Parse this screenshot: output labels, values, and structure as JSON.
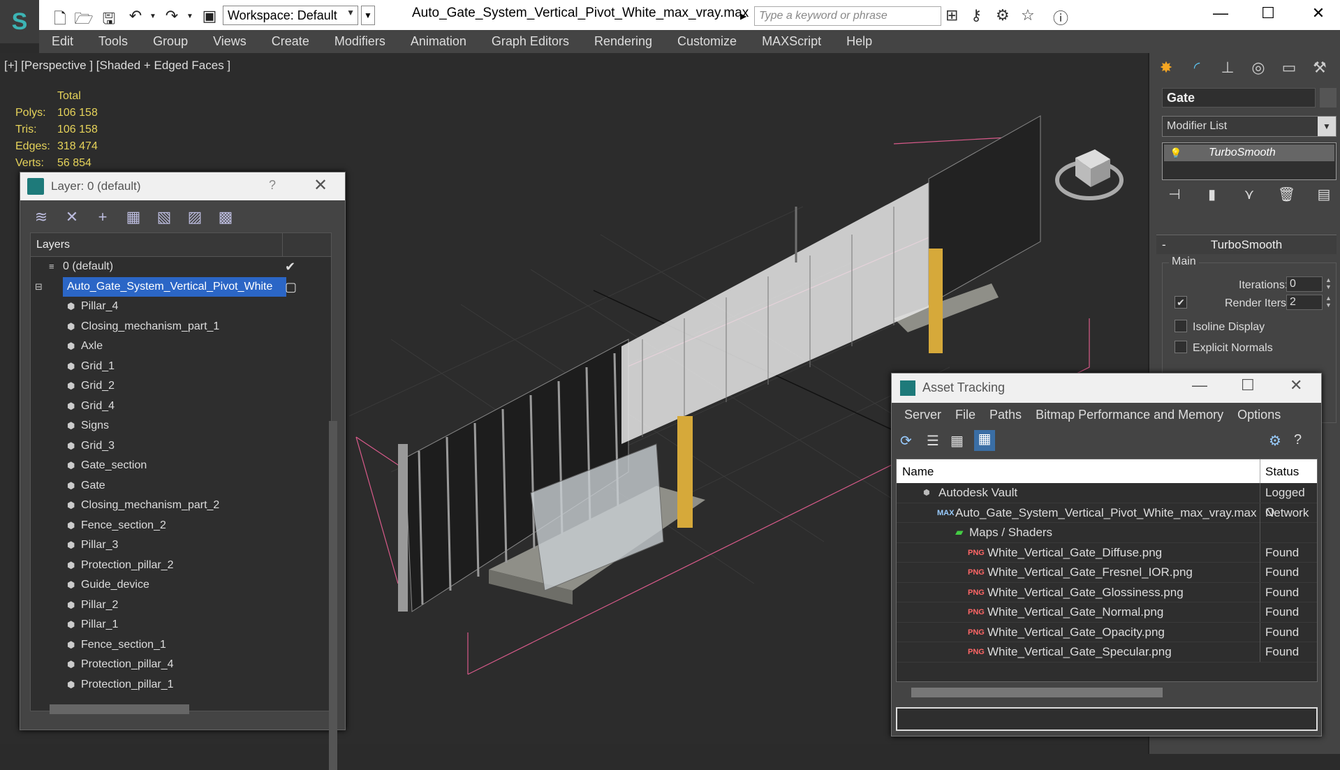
{
  "app": {
    "file_title": "Auto_Gate_System_Vertical_Pivot_White_max_vray.max",
    "workspace": "Workspace: Default",
    "search_placeholder": "Type a keyword or phrase"
  },
  "menu": [
    "Edit",
    "Tools",
    "Group",
    "Views",
    "Create",
    "Modifiers",
    "Animation",
    "Graph Editors",
    "Rendering",
    "Customize",
    "MAXScript",
    "Help"
  ],
  "viewport": {
    "label": "[+] [Perspective ] [Shaded + Edged Faces ]",
    "stats_header": "Total",
    "stats": [
      {
        "k": "Polys:",
        "v": "106 158"
      },
      {
        "k": "Tris:",
        "v": "106 158"
      },
      {
        "k": "Edges:",
        "v": "318 474"
      },
      {
        "k": "Verts:",
        "v": "56 854"
      }
    ]
  },
  "command_panel": {
    "object_name": "Gate",
    "modifier_list": "Modifier List",
    "stack_item": "TurboSmooth",
    "rollout_title": "TurboSmooth",
    "group_main": "Main",
    "iterations_label": "Iterations:",
    "iterations_value": "0",
    "render_iters_label": "Render Iters:",
    "render_iters_value": "2",
    "render_iters_checked": "✔",
    "isoline_label": "Isoline Display",
    "explicit_normals_label": "Explicit Normals"
  },
  "layer_window": {
    "title": "Layer: 0 (default)",
    "help": "?",
    "header": "Layers",
    "default_layer": "0 (default)",
    "selected_layer": "Auto_Gate_System_Vertical_Pivot_White",
    "objects": [
      "Pillar_4",
      "Closing_mechanism_part_1",
      "Axle",
      "Grid_1",
      "Grid_2",
      "Grid_4",
      "Signs",
      "Grid_3",
      "Gate_section",
      "Gate",
      "Closing_mechanism_part_2",
      "Fence_section_2",
      "Pillar_3",
      "Protection_pillar_2",
      "Guide_device",
      "Pillar_2",
      "Pillar_1",
      "Fence_section_1",
      "Protection_pillar_4",
      "Protection_pillar_1"
    ]
  },
  "asset_tracking": {
    "title": "Asset Tracking",
    "menu": [
      "Server",
      "File",
      "Paths",
      "Bitmap Performance and Memory",
      "Options"
    ],
    "col_name": "Name",
    "col_status": "Status",
    "rows": [
      {
        "name": "Autodesk Vault",
        "status": "Logged O",
        "indent": 0,
        "icon": "vault"
      },
      {
        "name": "Auto_Gate_System_Vertical_Pivot_White_max_vray.max",
        "status": "Network",
        "indent": 1,
        "icon": "max"
      },
      {
        "name": "Maps / Shaders",
        "status": "",
        "indent": 2,
        "icon": "maps"
      },
      {
        "name": "White_Vertical_Gate_Diffuse.png",
        "status": "Found",
        "indent": 3,
        "icon": "png"
      },
      {
        "name": "White_Vertical_Gate_Fresnel_IOR.png",
        "status": "Found",
        "indent": 3,
        "icon": "png"
      },
      {
        "name": "White_Vertical_Gate_Glossiness.png",
        "status": "Found",
        "indent": 3,
        "icon": "png"
      },
      {
        "name": "White_Vertical_Gate_Normal.png",
        "status": "Found",
        "indent": 3,
        "icon": "png"
      },
      {
        "name": "White_Vertical_Gate_Opacity.png",
        "status": "Found",
        "indent": 3,
        "icon": "png"
      },
      {
        "name": "White_Vertical_Gate_Specular.png",
        "status": "Found",
        "indent": 3,
        "icon": "png"
      }
    ]
  }
}
